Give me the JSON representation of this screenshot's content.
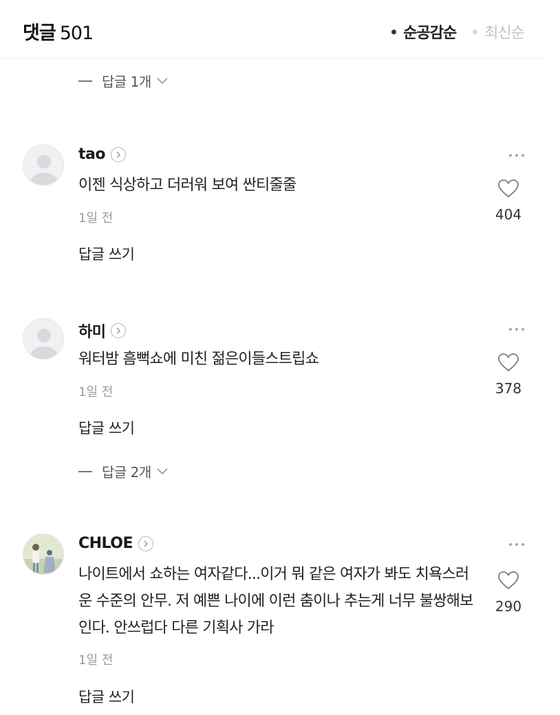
{
  "header": {
    "title": "댓글",
    "count": "501",
    "sort_options": [
      {
        "label": "순공감순",
        "active": true
      },
      {
        "label": "최신순",
        "active": false
      }
    ]
  },
  "top_reply_toggle": "답글 1개",
  "comments": [
    {
      "username": "tao",
      "text": "이젠 식상하고 더러워 보여 싼티줄줄",
      "time": "1일 전",
      "likes": "404",
      "write_reply": "답글 쓰기",
      "avatar": "default-avatar-icon"
    },
    {
      "username": "하미",
      "text": "워터밤 흠뻑쇼에 미친 젊은이들스트립쇼",
      "time": "1일 전",
      "likes": "378",
      "write_reply": "답글 쓰기",
      "reply_toggle": "답글 2개",
      "avatar": "default-avatar-icon"
    },
    {
      "username": "CHLOE",
      "text": "나이트에서 쇼하는 여자같다...이거 뭐 같은 여자가 봐도 치욕스러운 수준의 안무. 저 예쁜 나이에 이런 춤이나 추는게 너무 불쌍해보인다. 안쓰럽다 다른 기획사 가라",
      "time": "1일 전",
      "likes": "290",
      "write_reply": "답글 쓰기",
      "avatar": "illustration-avatar"
    }
  ],
  "colors": {
    "text_primary": "#222222",
    "text_muted": "#9a9a9a",
    "inactive_sort": "#c4c4c4",
    "divider": "#f0f0f0"
  }
}
